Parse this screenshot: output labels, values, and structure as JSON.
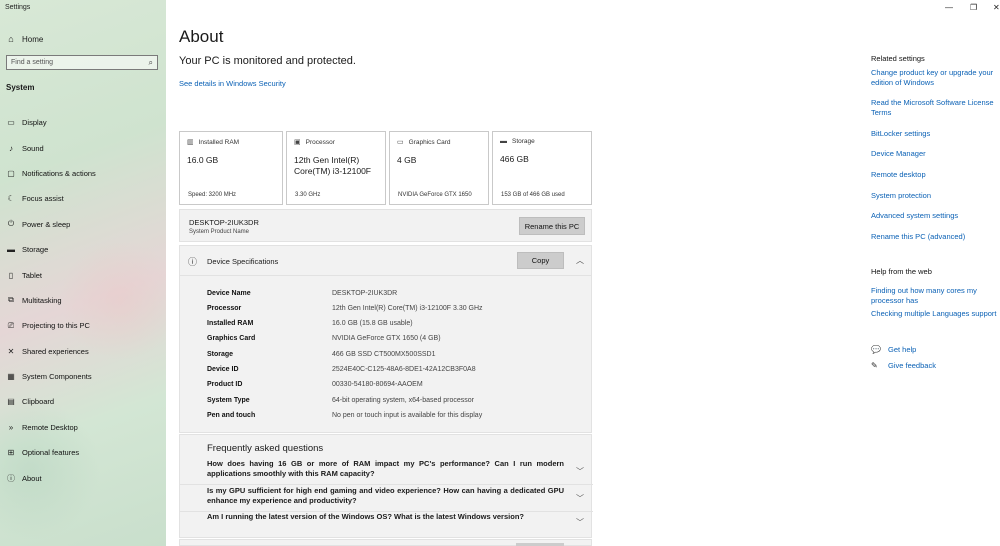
{
  "window": {
    "title": "Settings",
    "minimize": "—",
    "restore": "❐",
    "close": "✕"
  },
  "sidebar": {
    "home_label": "Home",
    "search_placeholder": "Find a setting",
    "section_label": "System",
    "items": [
      {
        "label": "Display",
        "icon": "display-icon"
      },
      {
        "label": "Sound",
        "icon": "sound-icon"
      },
      {
        "label": "Notifications & actions",
        "icon": "notifications-icon"
      },
      {
        "label": "Focus assist",
        "icon": "focus-assist-icon"
      },
      {
        "label": "Power & sleep",
        "icon": "power-icon"
      },
      {
        "label": "Storage",
        "icon": "storage-icon"
      },
      {
        "label": "Tablet",
        "icon": "tablet-icon"
      },
      {
        "label": "Multitasking",
        "icon": "multitasking-icon"
      },
      {
        "label": "Projecting to this PC",
        "icon": "projecting-icon"
      },
      {
        "label": "Shared experiences",
        "icon": "shared-experiences-icon"
      },
      {
        "label": "System Components",
        "icon": "system-components-icon"
      },
      {
        "label": "Clipboard",
        "icon": "clipboard-icon"
      },
      {
        "label": "Remote Desktop",
        "icon": "remote-desktop-icon"
      },
      {
        "label": "Optional features",
        "icon": "optional-features-icon"
      },
      {
        "label": "About",
        "icon": "info-icon"
      }
    ]
  },
  "main": {
    "title": "About",
    "protection_status": "Your PC is monitored and protected.",
    "security_link": "See details in Windows Security",
    "cards": [
      {
        "header": "Installed RAM",
        "value": "16.0 GB",
        "sub": "Speed: 3200 MHz",
        "icon": "ram-icon"
      },
      {
        "header": "Processor",
        "value": "12th Gen Intel(R) Core(TM) i3-12100F",
        "sub": "3.30 GHz",
        "icon": "processor-icon"
      },
      {
        "header": "Graphics Card",
        "value": "4 GB",
        "sub": "NVIDIA GeForce GTX 1650",
        "icon": "graphics-card-icon"
      },
      {
        "header": "Storage",
        "value": "466 GB",
        "sub": "153 GB of 466 GB used",
        "icon": "storage-drive-icon"
      }
    ],
    "pc_name": "DESKTOP-2IUK3DR",
    "pc_name_label": "System Product Name",
    "rename_button": "Rename this PC",
    "specs": {
      "title": "Device Specifications",
      "copy_button": "Copy",
      "rows": [
        {
          "key": "Device Name",
          "value": "DESKTOP-2IUK3DR"
        },
        {
          "key": "Processor",
          "value": "12th Gen Intel(R) Core(TM) i3-12100F   3.30 GHz"
        },
        {
          "key": "Installed RAM",
          "value": "16.0 GB (15.8 GB usable)"
        },
        {
          "key": "Graphics Card",
          "value": "NVIDIA GeForce GTX 1650 (4 GB)"
        },
        {
          "key": "Storage",
          "value": "466 GB SSD CT500MX500SSD1"
        },
        {
          "key": "Device ID",
          "value": "2524E40C-C125-48A6-8DE1-42A12CB3F0A8"
        },
        {
          "key": "Product ID",
          "value": "00330-54180-80694-AAOEM"
        },
        {
          "key": "System Type",
          "value": "64-bit operating system, x64-based processor"
        },
        {
          "key": "Pen and touch",
          "value": "No pen or touch input is available for this display"
        }
      ]
    },
    "faq": {
      "title": "Frequently asked questions",
      "items": [
        "How does having 16 GB or more of RAM impact my PC's performance? Can I run modern applications smoothly with this RAM capacity?",
        "Is my GPU sufficient for high end gaming and video experience? How can having a dedicated GPU enhance my experience and productivity?",
        "Am I running the latest version of the Windows OS? What is the latest Windows version?"
      ]
    }
  },
  "right": {
    "related_title": "Related settings",
    "related_links": [
      "Change product key or upgrade your edition of Windows",
      "Read the Microsoft Software License Terms",
      "BitLocker settings",
      "Device Manager",
      "Remote desktop",
      "System protection",
      "Advanced system settings",
      "Rename this PC (advanced)"
    ],
    "help_title": "Help from the web",
    "help_links": [
      "Finding out how many cores my processor has",
      "Checking multiple Languages support"
    ],
    "get_help": "Get help",
    "give_feedback": "Give feedback"
  },
  "colors": {
    "accent_link": "#0b61b5",
    "button_gray": "#cccccc",
    "panel_gray": "#f2f2f2"
  }
}
